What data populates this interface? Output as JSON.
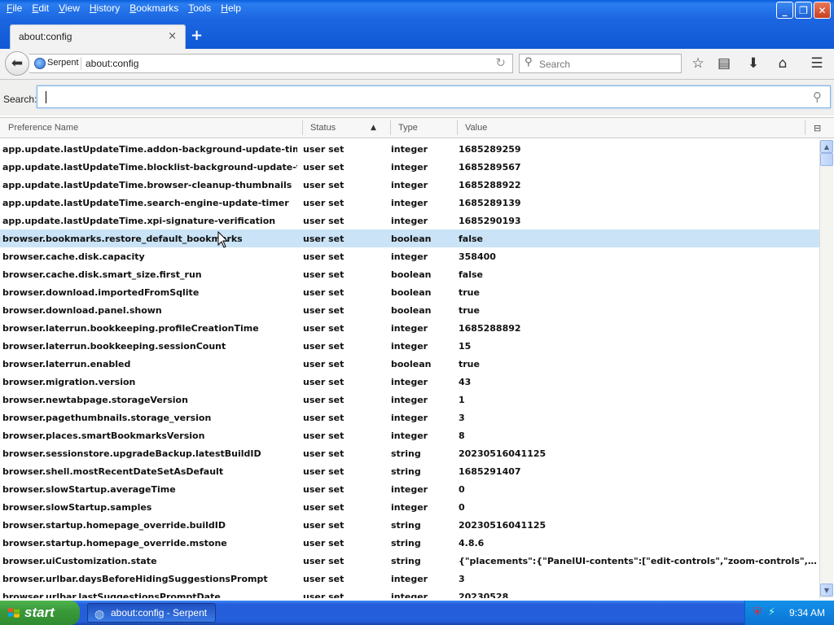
{
  "menu": [
    {
      "key": "F",
      "rest": "ile"
    },
    {
      "key": "E",
      "rest": "dit"
    },
    {
      "key": "V",
      "rest": "iew"
    },
    {
      "key": "H",
      "rest": "istory"
    },
    {
      "key": "B",
      "rest": "ookmarks"
    },
    {
      "key": "T",
      "rest": "ools"
    },
    {
      "key": "H",
      "rest": "elp"
    }
  ],
  "tab": {
    "title": "about:config",
    "close": "×"
  },
  "new_tab": "+",
  "nav": {
    "identity": "Serpent",
    "url": "about:config",
    "search_placeholder": "Search"
  },
  "filter": {
    "label": "Search:",
    "value": ""
  },
  "columns": {
    "name": "Preference Name",
    "status": "Status",
    "type": "Type",
    "value": "Value"
  },
  "rows": [
    {
      "name": "app.update.lastUpdateTime.addon-background-update-timer",
      "status": "user set",
      "type": "integer",
      "value": "1685289259"
    },
    {
      "name": "app.update.lastUpdateTime.blocklist-background-update-timer",
      "status": "user set",
      "type": "integer",
      "value": "1685289567"
    },
    {
      "name": "app.update.lastUpdateTime.browser-cleanup-thumbnails",
      "status": "user set",
      "type": "integer",
      "value": "1685288922"
    },
    {
      "name": "app.update.lastUpdateTime.search-engine-update-timer",
      "status": "user set",
      "type": "integer",
      "value": "1685289139"
    },
    {
      "name": "app.update.lastUpdateTime.xpi-signature-verification",
      "status": "user set",
      "type": "integer",
      "value": "1685290193"
    },
    {
      "name": "browser.bookmarks.restore_default_bookmarks",
      "status": "user set",
      "type": "boolean",
      "value": "false",
      "selected": true
    },
    {
      "name": "browser.cache.disk.capacity",
      "status": "user set",
      "type": "integer",
      "value": "358400"
    },
    {
      "name": "browser.cache.disk.smart_size.first_run",
      "status": "user set",
      "type": "boolean",
      "value": "false"
    },
    {
      "name": "browser.download.importedFromSqlite",
      "status": "user set",
      "type": "boolean",
      "value": "true"
    },
    {
      "name": "browser.download.panel.shown",
      "status": "user set",
      "type": "boolean",
      "value": "true"
    },
    {
      "name": "browser.laterrun.bookkeeping.profileCreationTime",
      "status": "user set",
      "type": "integer",
      "value": "1685288892"
    },
    {
      "name": "browser.laterrun.bookkeeping.sessionCount",
      "status": "user set",
      "type": "integer",
      "value": "15"
    },
    {
      "name": "browser.laterrun.enabled",
      "status": "user set",
      "type": "boolean",
      "value": "true"
    },
    {
      "name": "browser.migration.version",
      "status": "user set",
      "type": "integer",
      "value": "43"
    },
    {
      "name": "browser.newtabpage.storageVersion",
      "status": "user set",
      "type": "integer",
      "value": "1"
    },
    {
      "name": "browser.pagethumbnails.storage_version",
      "status": "user set",
      "type": "integer",
      "value": "3"
    },
    {
      "name": "browser.places.smartBookmarksVersion",
      "status": "user set",
      "type": "integer",
      "value": "8"
    },
    {
      "name": "browser.sessionstore.upgradeBackup.latestBuildID",
      "status": "user set",
      "type": "string",
      "value": "20230516041125"
    },
    {
      "name": "browser.shell.mostRecentDateSetAsDefault",
      "status": "user set",
      "type": "string",
      "value": "1685291407"
    },
    {
      "name": "browser.slowStartup.averageTime",
      "status": "user set",
      "type": "integer",
      "value": "0"
    },
    {
      "name": "browser.slowStartup.samples",
      "status": "user set",
      "type": "integer",
      "value": "0"
    },
    {
      "name": "browser.startup.homepage_override.buildID",
      "status": "user set",
      "type": "string",
      "value": "20230516041125"
    },
    {
      "name": "browser.startup.homepage_override.mstone",
      "status": "user set",
      "type": "string",
      "value": "4.8.6"
    },
    {
      "name": "browser.uiCustomization.state",
      "status": "user set",
      "type": "string",
      "value": "{\"placements\":{\"PanelUI-contents\":[\"edit-controls\",\"zoom-controls\",\"new..."
    },
    {
      "name": "browser.urlbar.daysBeforeHidingSuggestionsPrompt",
      "status": "user set",
      "type": "integer",
      "value": "3"
    },
    {
      "name": "browser.urlbar.lastSuggestionsPromptDate",
      "status": "user set",
      "type": "integer",
      "value": "20230528"
    }
  ],
  "taskbar": {
    "start": "start",
    "task": "about:config - Serpent",
    "clock": "9:34 AM"
  },
  "colors": {
    "selected_row": "#cae3f6",
    "titlebar": "#1b66e0",
    "start_green": "#3a9a3a"
  }
}
